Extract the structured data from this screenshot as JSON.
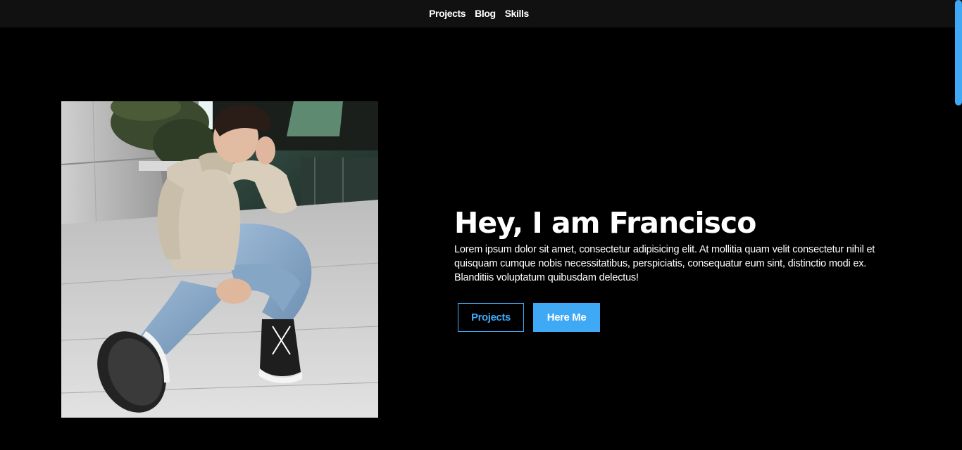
{
  "nav": {
    "items": [
      {
        "label": "Projects"
      },
      {
        "label": "Blog"
      },
      {
        "label": "Skills"
      }
    ]
  },
  "hero": {
    "title": "Hey, I am Francisco",
    "description": "Lorem ipsum dolor sit amet, consectetur adipisicing elit. At mollitia quam velit consectetur nihil et quisquam cumque nobis necessitatibus, perspiciatis, consequatur eum sint, distinctio modi ex. Blanditiis voluptatum quibusdam delectus!",
    "buttons": {
      "primary_label": "Projects",
      "secondary_label": "Here Me"
    }
  },
  "colors": {
    "accent": "#3fa9f5",
    "background": "#000000",
    "topbar": "#111111",
    "text": "#ffffff"
  },
  "icons": {
    "photo": "profile-photo"
  }
}
